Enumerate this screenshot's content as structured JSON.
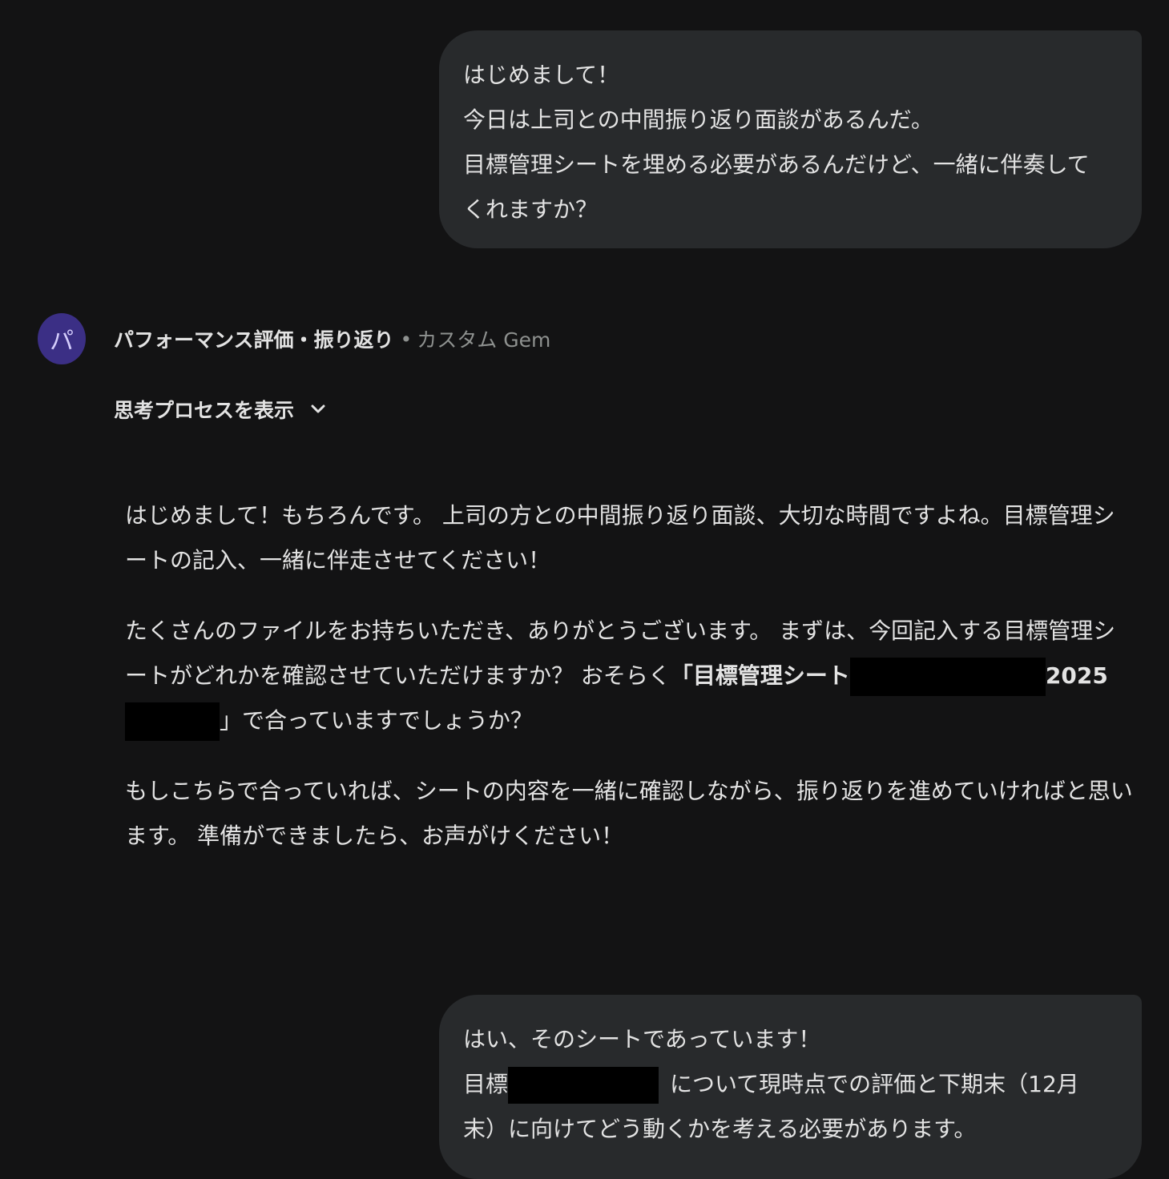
{
  "messages": {
    "user_1": {
      "lines": [
        "はじめまして！",
        "今日は上司との中間振り返り面談があるんだ。",
        "目標管理シートを埋める必要があるんだけど、一緒に伴奏して",
        "くれますか？"
      ]
    },
    "gem": {
      "avatar_letter": "パ",
      "name": "パフォーマンス評価・振り返り",
      "separator": "•",
      "type": "カスタム Gem",
      "thinking_toggle_label": "思考プロセスを表示",
      "p1": "はじめまして！もちろんです。 上司の方との中間振り返り面談、大切な時間ですよね。目標管理シートの記入、一緒に伴走させてください！",
      "p2_start": "たくさんのファイルをお持ちいただき、ありがとうございます。 まずは、今回記入する目標管理シートがどれかを確認させていただけますか？ おそらく",
      "p2_bold_1": "「目標管理シート",
      "p2_bold_2": "2025",
      "p2_end": "」で合っていますでしょうか？",
      "p3": "もしこちらで合っていれば、シートの内容を一緒に確認しながら、振り返りを進めていければと思います。 準備ができましたら、お声がけください！"
    },
    "user_2": {
      "line1": "はい、そのシートであっています！",
      "line2_start": "目標",
      "line2_end": "について現時点での評価と下期末（12月",
      "line3": "末）に向けてどう動くかを考える必要があります。"
    }
  },
  "colors": {
    "background": "#131314",
    "bubble": "#282a2c",
    "avatar": "#3b2f85",
    "text": "#e3e3e3",
    "muted": "#8e918f",
    "redaction": "#000000"
  },
  "icons": {
    "thinking_toggle": "chevron-down-icon"
  }
}
